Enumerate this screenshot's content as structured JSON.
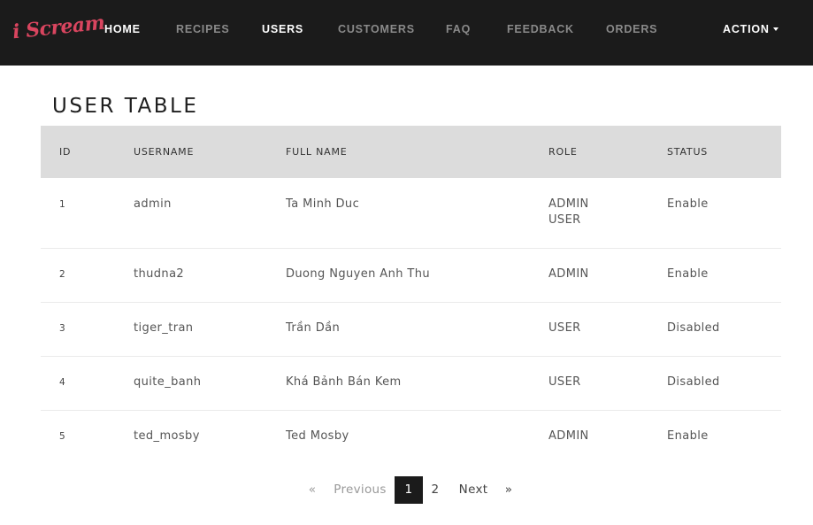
{
  "brand": {
    "logo_text": "i Scream"
  },
  "nav": {
    "items": [
      {
        "label": "HOME"
      },
      {
        "label": "RECIPES"
      },
      {
        "label": "USERS"
      },
      {
        "label": "CUSTOMERS"
      },
      {
        "label": "FAQ"
      },
      {
        "label": "FEEDBACK"
      },
      {
        "label": "ORDERS"
      }
    ],
    "action_label": "ACTION",
    "colors": {
      "background": "#1b1b1b",
      "active": "#ffffff",
      "inactive": "#8a8a8a",
      "logo": "#d9455f"
    }
  },
  "page": {
    "title": "USER TABLE"
  },
  "table": {
    "headers": [
      "ID",
      "USERNAME",
      "FULL NAME",
      "ROLE",
      "STATUS"
    ],
    "rows": [
      {
        "id": "1",
        "username": "admin",
        "full_name": "Ta Minh Duc",
        "roles": [
          "ADMIN",
          "USER"
        ],
        "status": "Enable"
      },
      {
        "id": "2",
        "username": "thudna2",
        "full_name": "Duong Nguyen Anh Thu",
        "roles": [
          "ADMIN"
        ],
        "status": "Enable"
      },
      {
        "id": "3",
        "username": "tiger_tran",
        "full_name": "Trần Dần",
        "roles": [
          "USER"
        ],
        "status": "Disabled"
      },
      {
        "id": "4",
        "username": "quite_banh",
        "full_name": "Khá Bảnh Bán Kem",
        "roles": [
          "USER"
        ],
        "status": "Disabled"
      },
      {
        "id": "5",
        "username": "ted_mosby",
        "full_name": "Ted Mosby",
        "roles": [
          "ADMIN"
        ],
        "status": "Enable"
      }
    ]
  },
  "pagination": {
    "first": "«",
    "previous": "Previous",
    "pages": [
      "1",
      "2"
    ],
    "current": "1",
    "next": "Next",
    "last": "»"
  }
}
